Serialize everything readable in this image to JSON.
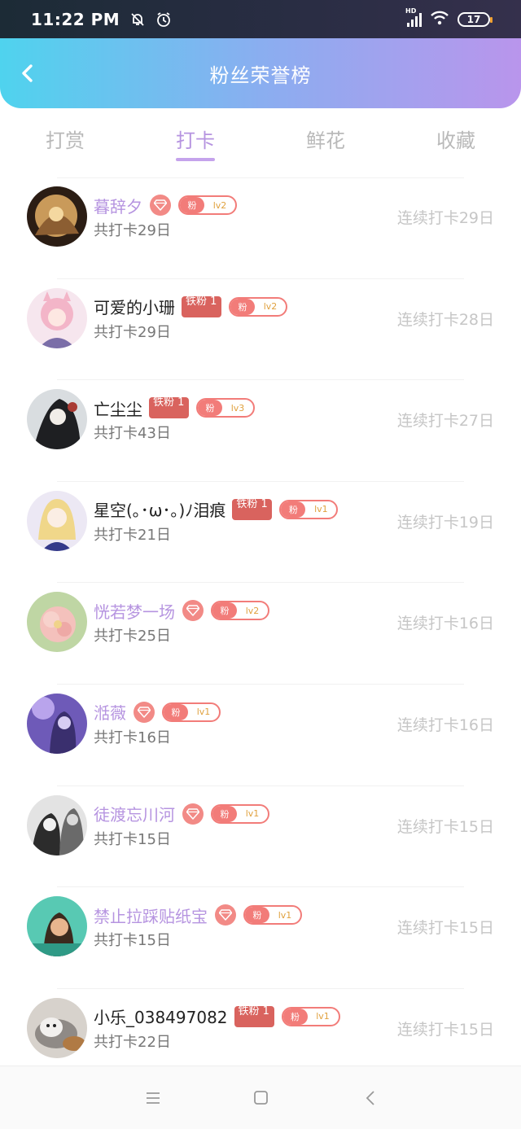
{
  "status_bar": {
    "time": "11:22 PM",
    "battery": "17",
    "network": "HD"
  },
  "header": {
    "title": "粉丝荣誉榜"
  },
  "tabs": [
    {
      "label": "打赏",
      "active": false
    },
    {
      "label": "打卡",
      "active": true
    },
    {
      "label": "鲜花",
      "active": false
    },
    {
      "label": "收藏",
      "active": false
    }
  ],
  "list": [
    {
      "name": "暮辞夕",
      "vip": true,
      "tiefen": "",
      "fan_label": "粉",
      "level": "lv2",
      "total": "共打卡29日",
      "streak": "连续打卡29日",
      "avatar_icon": "avatar-golden-art"
    },
    {
      "name": "可爱的小珊",
      "vip": false,
      "tiefen": "铁粉 1",
      "fan_label": "粉",
      "level": "lv2",
      "total": "共打卡29日",
      "streak": "连续打卡28日",
      "avatar_icon": "avatar-pink-girl"
    },
    {
      "name": "亡尘尘",
      "vip": false,
      "tiefen": "铁粉 1",
      "fan_label": "粉",
      "level": "lv3",
      "total": "共打卡43日",
      "streak": "连续打卡27日",
      "avatar_icon": "avatar-dark-art"
    },
    {
      "name": "星空(｡･ω･｡)ﾉ泪痕",
      "vip": false,
      "tiefen": "铁粉 1",
      "fan_label": "粉",
      "level": "lv1",
      "total": "共打卡21日",
      "streak": "连续打卡19日",
      "avatar_icon": "avatar-anime-blonde"
    },
    {
      "name": "恍若梦一场",
      "vip": true,
      "tiefen": "",
      "fan_label": "粉",
      "level": "lv2",
      "total": "共打卡25日",
      "streak": "连续打卡16日",
      "avatar_icon": "avatar-flower"
    },
    {
      "name": "湉薇",
      "vip": true,
      "tiefen": "",
      "fan_label": "粉",
      "level": "lv1",
      "total": "共打卡16日",
      "streak": "连续打卡16日",
      "avatar_icon": "avatar-purple-girl"
    },
    {
      "name": "徒渡忘川河",
      "vip": true,
      "tiefen": "",
      "fan_label": "粉",
      "level": "lv1",
      "total": "共打卡15日",
      "streak": "连续打卡15日",
      "avatar_icon": "avatar-bw-couple"
    },
    {
      "name": "禁止拉踩贴纸宝",
      "vip": true,
      "tiefen": "",
      "fan_label": "粉",
      "level": "lv1",
      "total": "共打卡15日",
      "streak": "连续打卡15日",
      "avatar_icon": "avatar-teal-person"
    },
    {
      "name": "小乐_038497082",
      "vip": false,
      "tiefen": "铁粉 1",
      "fan_label": "粉",
      "level": "lv1",
      "total": "共打卡22日",
      "streak": "连续打卡15日",
      "avatar_icon": "avatar-dog"
    }
  ],
  "colors": {
    "accent": "#b694e0",
    "fan": "#f27c79",
    "tiefen": "#d9635e",
    "header_start": "#4fd3ee",
    "header_end": "#b995ec"
  }
}
